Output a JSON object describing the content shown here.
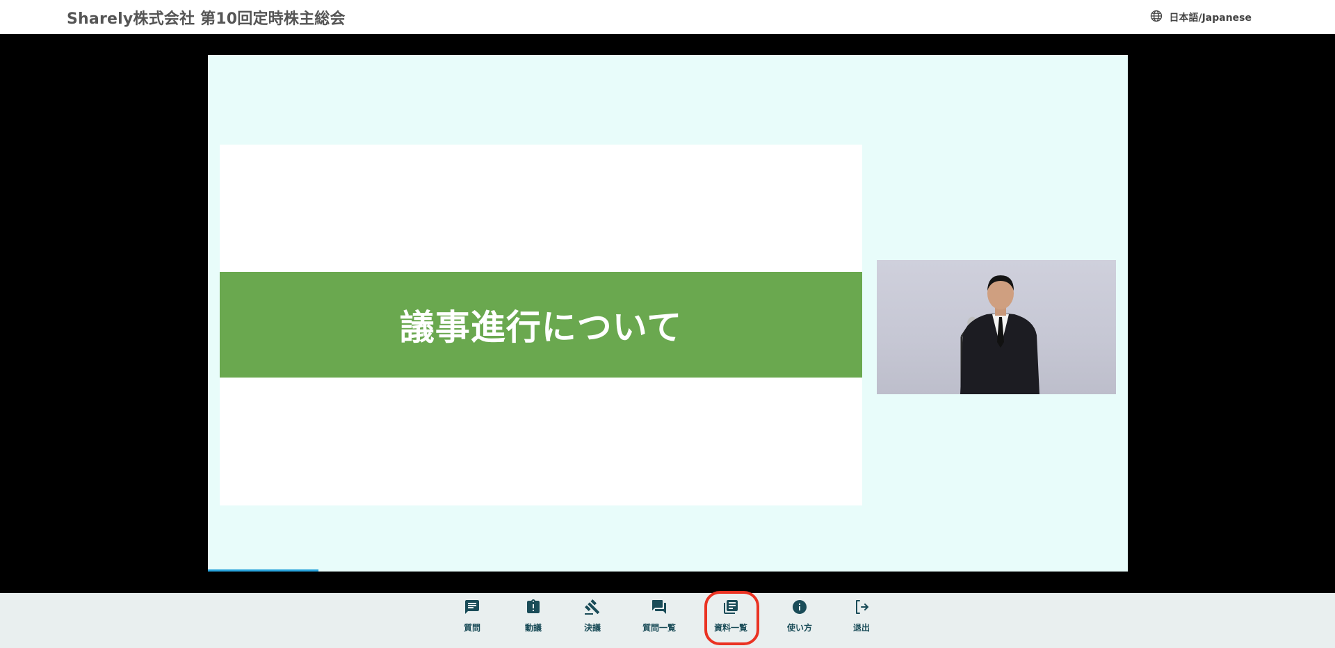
{
  "header": {
    "title": "Sharely株式会社 第10回定時株主総会",
    "language_label": "日本語/Japanese"
  },
  "slide": {
    "heading": "議事進行について"
  },
  "toolbar": {
    "items": [
      {
        "label": "質問",
        "icon": "chat-icon"
      },
      {
        "label": "動議",
        "icon": "alert-clipboard-icon"
      },
      {
        "label": "決議",
        "icon": "gavel-icon"
      },
      {
        "label": "質問一覧",
        "icon": "forum-icon"
      },
      {
        "label": "資料一覧",
        "icon": "library-books-icon"
      },
      {
        "label": "使い方",
        "icon": "info-icon"
      },
      {
        "label": "退出",
        "icon": "logout-icon"
      }
    ]
  },
  "colors": {
    "accent": "#1a4c58",
    "slide_band": "#6aa84f",
    "player_background": "#e8fcfa",
    "highlight": "#ea3323",
    "progress": "#27a3dc"
  },
  "video": {
    "progress_fraction": 0.12
  }
}
